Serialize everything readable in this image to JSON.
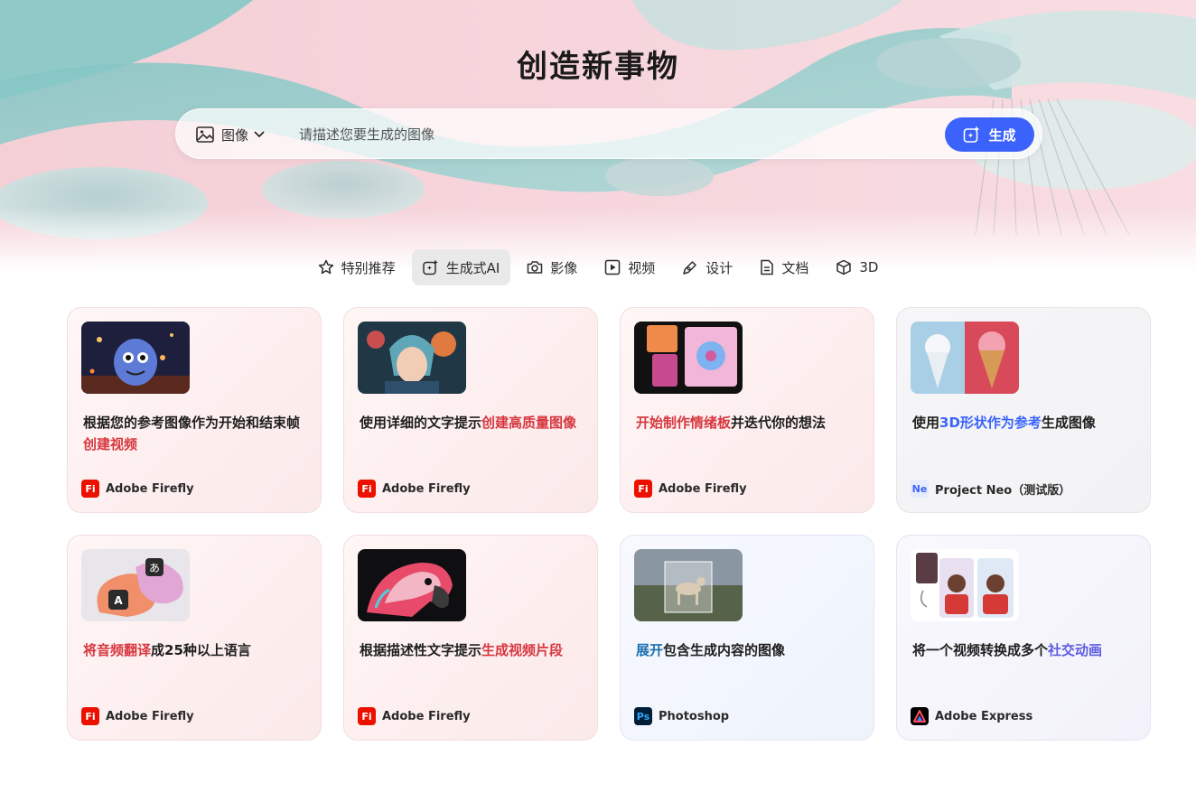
{
  "header": {
    "title": "创造新事物"
  },
  "search": {
    "type_label": "图像",
    "placeholder": "请描述您要生成的图像",
    "generate_label": "生成"
  },
  "tabs": [
    {
      "label": "特别推荐",
      "icon": "star-icon"
    },
    {
      "label": "生成式AI",
      "icon": "sparkle-frame-icon",
      "active": true
    },
    {
      "label": "影像",
      "icon": "camera-icon"
    },
    {
      "label": "视频",
      "icon": "play-icon"
    },
    {
      "label": "设计",
      "icon": "pen-icon"
    },
    {
      "label": "文档",
      "icon": "document-icon"
    },
    {
      "label": "3D",
      "icon": "cube-icon"
    }
  ],
  "cards": [
    {
      "text": [
        "根据您的参考图像作为开始和结束帧",
        "创建视频"
      ],
      "app": "Adobe Firefly",
      "app_icon": "Fi",
      "thumb": "fluffy blue monster in glowing forest"
    },
    {
      "text": [
        "使用详细的文字提示",
        "创建高质量图像"
      ],
      "app": "Adobe Firefly",
      "app_icon": "Fi",
      "thumb": "anime portrait with flowers"
    },
    {
      "text": [
        "开始制作情绪板",
        "并迭代你的想法"
      ],
      "app": "Adobe Firefly",
      "app_icon": "Fi",
      "thumb": "moodboard collage"
    },
    {
      "text": [
        "使用",
        "3D形状作为参考",
        "生成图像"
      ],
      "app": "Project Neo（测试版）",
      "app_icon": "Ne",
      "thumb": "ice cream cone 3D"
    },
    {
      "text": [
        "将音频翻译",
        "成25种以上语言"
      ],
      "app": "Adobe Firefly",
      "app_icon": "Fi",
      "thumb": "translation bubbles",
      "thumb_letters": [
        "あ",
        "A"
      ]
    },
    {
      "text": [
        "根据描述性文字提示",
        "生成视频片段"
      ],
      "app": "Adobe Firefly",
      "app_icon": "Fi",
      "thumb": "colorful parrot"
    },
    {
      "text": [
        "展开",
        "包含生成内容的图像"
      ],
      "app": "Photoshop",
      "app_icon": "Ps",
      "thumb": "horse on coast"
    },
    {
      "text": [
        "将一个视频转换成多个",
        "社交动画"
      ],
      "app": "Adobe Express",
      "app_icon": "A",
      "thumb": "social video frames"
    }
  ],
  "colors": {
    "accent": "#3b63fb",
    "firefly": "#eb1000",
    "highlight_red": "#d7373f"
  }
}
